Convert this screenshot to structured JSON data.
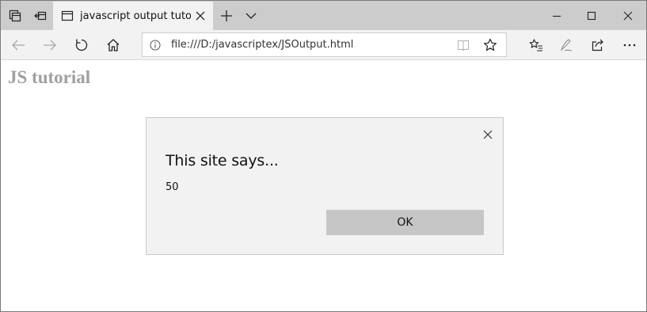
{
  "browser": {
    "tab": {
      "title": "javascript output tutoria"
    },
    "address_bar": {
      "url": "file:///D:/javascriptex/JSOutput.html"
    }
  },
  "page": {
    "heading": "JS tutorial"
  },
  "dialog": {
    "title": "This site says...",
    "message": "50",
    "ok_label": "OK"
  },
  "colors": {
    "titlebar": "#cccccc",
    "navbar": "#f2f2f2",
    "heading": "#a0a0a0",
    "dialog_bg": "#f2f2f2",
    "ok_button": "#c6c6c6"
  }
}
